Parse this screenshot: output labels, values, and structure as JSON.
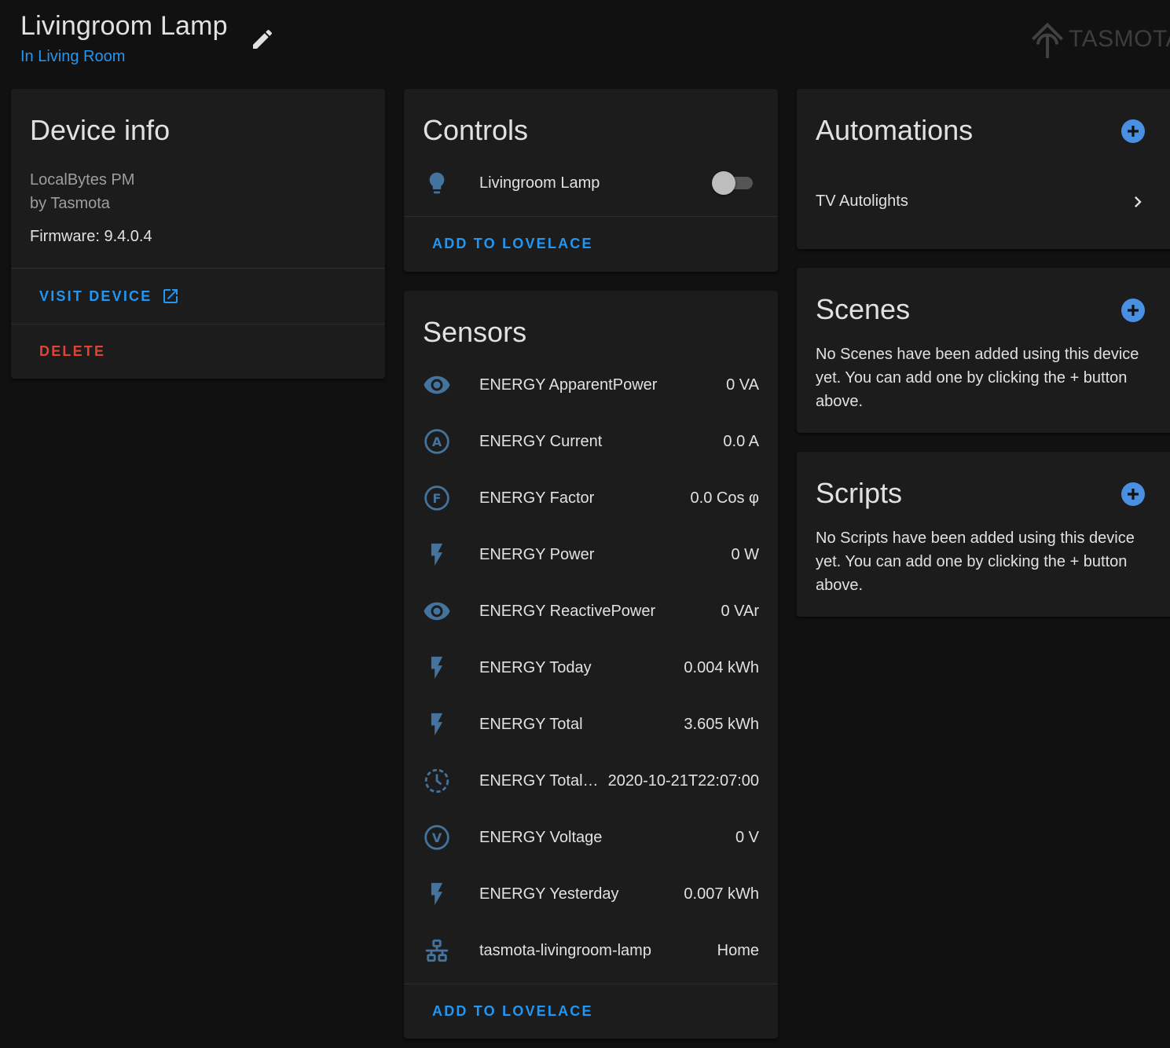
{
  "header": {
    "title": "Livingroom Lamp",
    "area": "In Living Room",
    "brand": "TASMOTA"
  },
  "device_info": {
    "title": "Device info",
    "model": "LocalBytes PM",
    "manufacturer": "by Tasmota",
    "firmware": "Firmware: 9.4.0.4",
    "visit_label": "VISIT DEVICE",
    "delete_label": "DELETE"
  },
  "controls": {
    "title": "Controls",
    "items": [
      {
        "icon": "lightbulb-icon",
        "name": "Livingroom Lamp",
        "state": "off"
      }
    ],
    "add_label": "ADD TO LOVELACE"
  },
  "sensors": {
    "title": "Sensors",
    "items": [
      {
        "icon": "eye-icon",
        "name": "ENERGY ApparentPower",
        "value": "0 VA"
      },
      {
        "icon": "alpha-a-circle-icon",
        "name": "ENERGY Current",
        "value": "0.0 A"
      },
      {
        "icon": "alpha-f-circle-icon",
        "name": "ENERGY Factor",
        "value": "0.0 Cos φ"
      },
      {
        "icon": "flash-icon",
        "name": "ENERGY Power",
        "value": "0 W"
      },
      {
        "icon": "eye-icon",
        "name": "ENERGY ReactivePower",
        "value": "0 VAr"
      },
      {
        "icon": "flash-icon",
        "name": "ENERGY Today",
        "value": "0.004 kWh"
      },
      {
        "icon": "flash-icon",
        "name": "ENERGY Total",
        "value": "3.605 kWh"
      },
      {
        "icon": "clock-outline-icon",
        "name": "ENERGY Total…",
        "value": "2020-10-21T22:07:00"
      },
      {
        "icon": "alpha-v-circle-icon",
        "name": "ENERGY Voltage",
        "value": "0 V"
      },
      {
        "icon": "flash-icon",
        "name": "ENERGY Yesterday",
        "value": "0.007 kWh"
      },
      {
        "icon": "lan-icon",
        "name": "tasmota-livingroom-lamp",
        "value": "Home"
      }
    ],
    "add_label": "ADD TO LOVELACE"
  },
  "automations": {
    "title": "Automations",
    "items": [
      {
        "name": "TV Autolights"
      }
    ]
  },
  "scenes": {
    "title": "Scenes",
    "note": "No Scenes have been added using this device yet. You can add one by clicking the + button above."
  },
  "scripts": {
    "title": "Scripts",
    "note": "No Scripts have been added using this device yet. You can add one by clicking the + button above."
  },
  "colors": {
    "background": "#111111",
    "card": "#1c1c1c",
    "primary": "#2196f3",
    "danger": "#db4437",
    "state_icon": "#44739e",
    "add_button": "#4a90e2"
  }
}
